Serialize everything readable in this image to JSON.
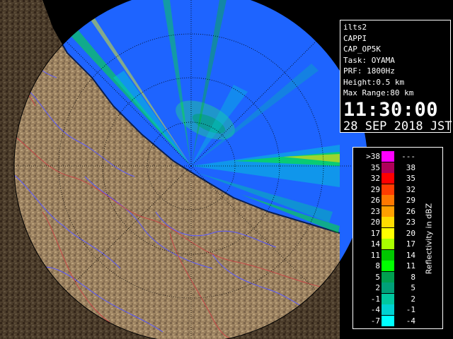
{
  "info": {
    "lines": [
      "ilts2",
      "CAPPI",
      "CAP_OP5K",
      "Task: OYAMA",
      "PRF: 1800Hz",
      "Height:0.5 km",
      "Max Range:80 km"
    ],
    "time": "11:30:00",
    "date": "28 SEP 2018 JST"
  },
  "legend": {
    "title": "Reflectivity in dBZ",
    "rows": [
      {
        "lo": ">38",
        "hi": "---",
        "color": "#ff00ff"
      },
      {
        "lo": "35",
        "hi": "38",
        "color": "#b0005a"
      },
      {
        "lo": "32",
        "hi": "35",
        "color": "#ff0000"
      },
      {
        "lo": "29",
        "hi": "32",
        "color": "#ff3c00"
      },
      {
        "lo": "26",
        "hi": "29",
        "color": "#ff7800"
      },
      {
        "lo": "23",
        "hi": "26",
        "color": "#ffa000"
      },
      {
        "lo": "20",
        "hi": "23",
        "color": "#ffdc00"
      },
      {
        "lo": "17",
        "hi": "20",
        "color": "#ffff00"
      },
      {
        "lo": "14",
        "hi": "17",
        "color": "#a8ff00"
      },
      {
        "lo": "11",
        "hi": "14",
        "color": "#00c800"
      },
      {
        "lo": "8",
        "hi": "11",
        "color": "#00ff00"
      },
      {
        "lo": "5",
        "hi": "8",
        "color": "#00a050"
      },
      {
        "lo": "2",
        "hi": "5",
        "color": "#00a078"
      },
      {
        "lo": "-1",
        "hi": "2",
        "color": "#00c8a0"
      },
      {
        "lo": "-4",
        "hi": "-1",
        "color": "#00d2d2"
      },
      {
        "lo": "-7",
        "hi": "-4",
        "color": "#00ffff"
      }
    ]
  },
  "colors": {
    "sea": "#1e64ff",
    "land": "#8c7050",
    "rivers": "#5a5aff",
    "borders": "#c84646",
    "range_rings": "#000000"
  }
}
